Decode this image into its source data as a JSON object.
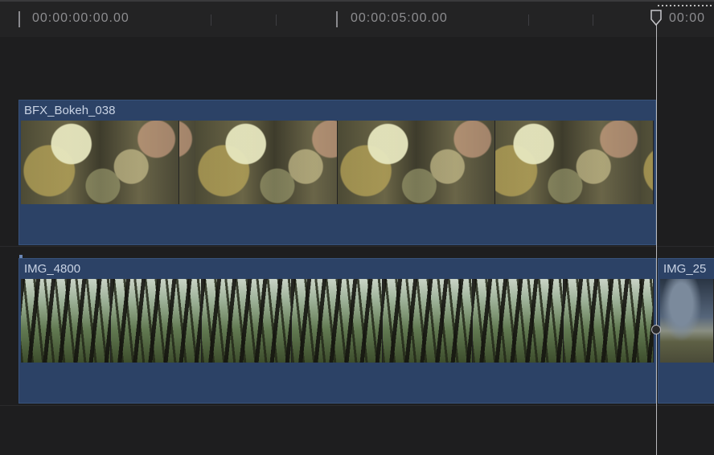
{
  "ruler": {
    "timecodes": [
      "00:00:00:00.00",
      "00:00:05:00.00",
      "00:00"
    ]
  },
  "clips": [
    {
      "name": "BFX_Bokeh_038",
      "type": "bokeh"
    },
    {
      "name": "IMG_4800",
      "type": "forest"
    },
    {
      "name": "IMG_25",
      "type": "clouds"
    }
  ],
  "colors": {
    "background": "#1e1e1f",
    "clip_fill": "#2c4266",
    "clip_label": "#c9d3e4",
    "playhead": "#b9b9bd",
    "timecode": "#8d8d90"
  },
  "icons": {
    "playhead": "playhead-marker-icon",
    "edit_point": "edit-point-knob-icon"
  }
}
